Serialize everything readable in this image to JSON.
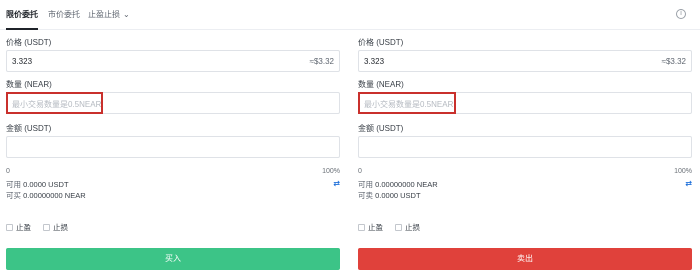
{
  "tabs": {
    "limit": "限价委托",
    "market": "市价委托",
    "stop": "止盈止损"
  },
  "buy": {
    "price_label": "价格 (USDT)",
    "price_value": "3.323",
    "price_suffix": "≈$3.32",
    "qty_label": "数量 (NEAR)",
    "qty_placeholder": "最小交易数量是0.5NEAR",
    "amount_label": "金额 (USDT)",
    "slider_min": "0",
    "slider_max": "100%",
    "available_label": "可用",
    "available_value": "0.0000 USDT",
    "can_buy_label": "可买",
    "can_buy_value": "0.00000000 NEAR",
    "tp_label": "止盈",
    "sl_label": "止损",
    "button_label": "买入"
  },
  "sell": {
    "price_label": "价格 (USDT)",
    "price_value": "3.323",
    "price_suffix": "≈$3.32",
    "qty_label": "数量 (NEAR)",
    "qty_placeholder": "最小交易数量是0.5NEAR",
    "amount_label": "金额 (USDT)",
    "slider_min": "0",
    "slider_max": "100%",
    "available_label": "可用",
    "available_value": "0.00000000 NEAR",
    "can_sell_label": "可卖",
    "can_sell_value": "0.0000 USDT",
    "tp_label": "止盈",
    "sl_label": "止损",
    "button_label": "卖出"
  },
  "colors": {
    "buy": "#3cc487",
    "sell": "#e0413b",
    "highlight": "#c9302c",
    "swap": "#1e6fd9"
  },
  "icons": {
    "info": "info-icon",
    "swap": "swap-icon",
    "chevron": "chevron-down-icon"
  }
}
